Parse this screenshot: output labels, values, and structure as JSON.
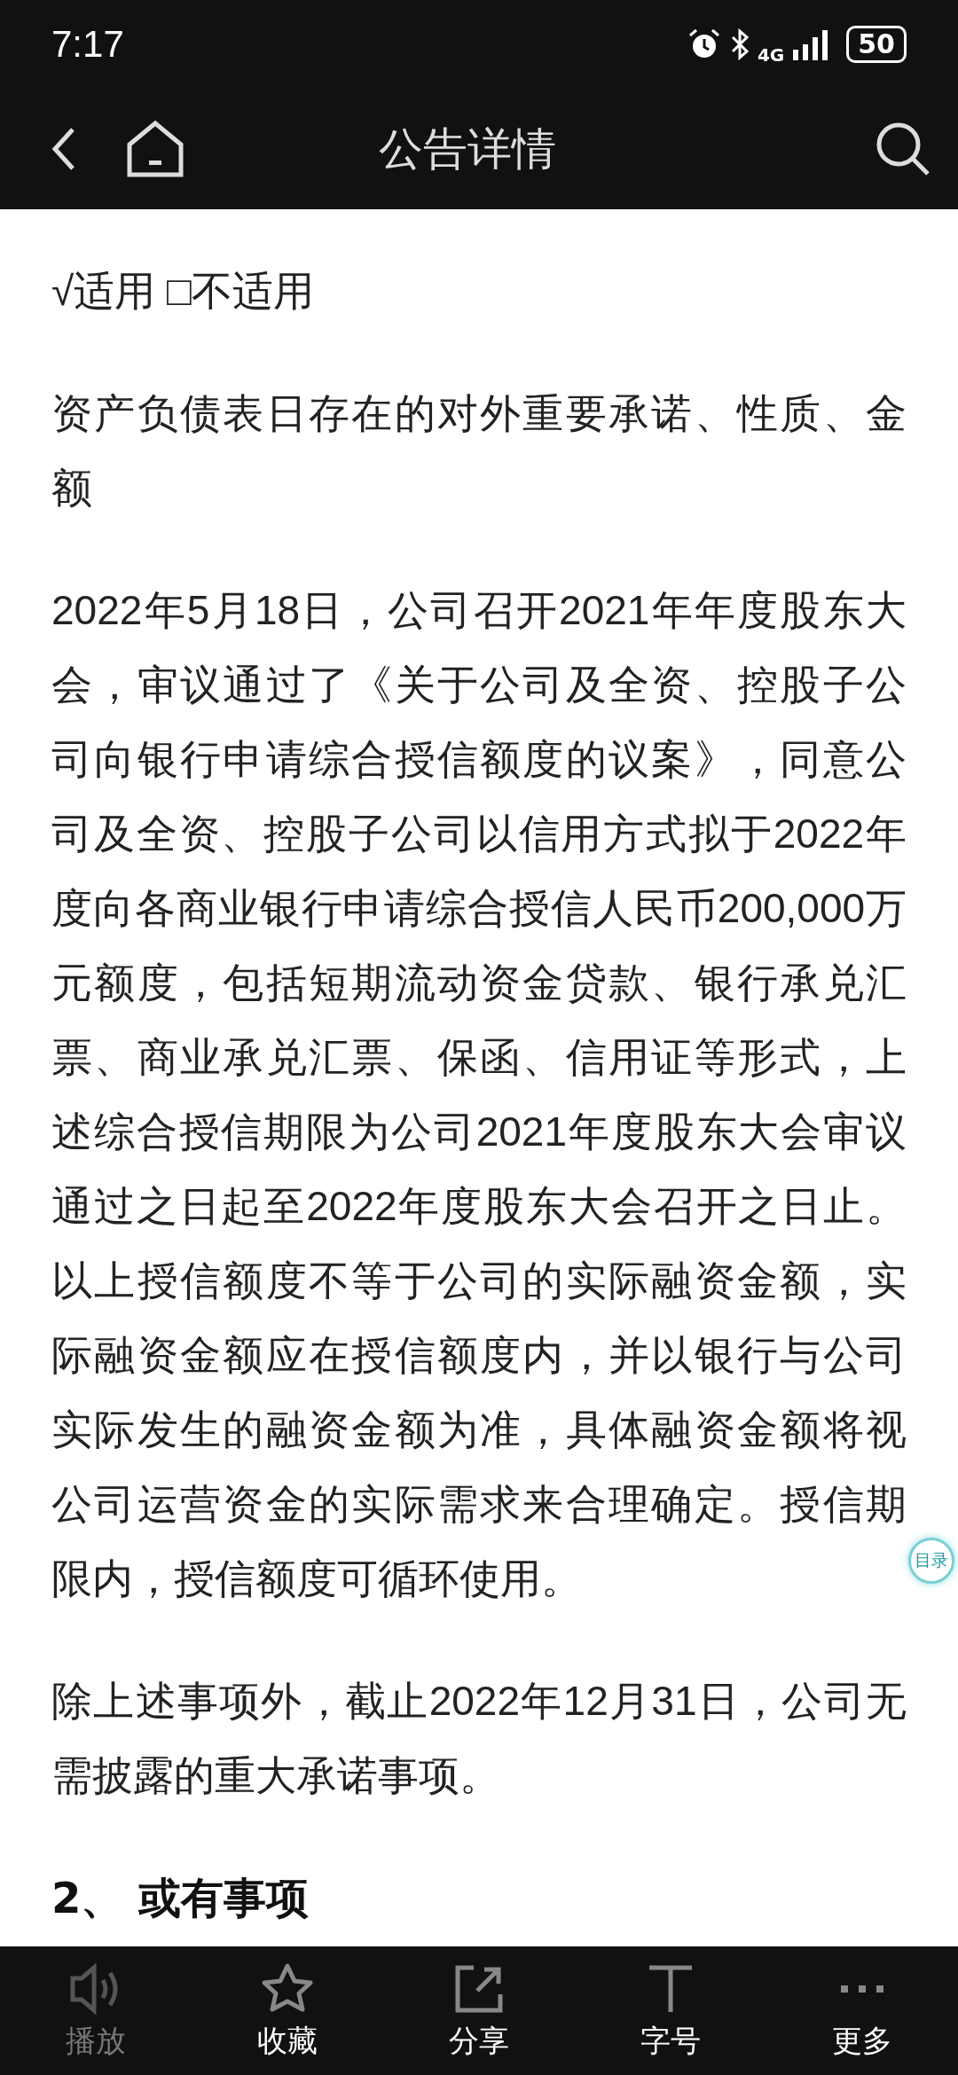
{
  "status_bar": {
    "time": "7:17",
    "network": "4G",
    "battery": "50"
  },
  "header": {
    "title": "公告详情"
  },
  "content": [
    {
      "kind": "paragraph",
      "text": "√适用 □不适用"
    },
    {
      "kind": "paragraph",
      "text": "资产负债表日存在的对外重要承诺、性质、金额"
    },
    {
      "kind": "paragraph",
      "text": "2022年5月18日，公司召开2021年年度股东大会，审议通过了《关于公司及全资、控股子公司向银行申请综合授信额度的议案》，同意公司及全资、控股子公司以信用方式拟于2022年度向各商业银行申请综合授信人民币200,000万元额度，包括短期流动资金贷款、银行承兑汇票、商业承兑汇票、保函、信用证等形式，上述综合授信期限为公司2021年度股东大会审议通过之日起至2022年度股东大会召开之日止。以上授信额度不等于公司的实际融资金额，实际融资金额应在授信额度内，并以银行与公司实际发生的融资金额为准，具体融资金额将视公司运营资金的实际需求来合理确定。授信期限内，授信额度可循环使用。"
    },
    {
      "kind": "paragraph",
      "text": "除上述事项外，截止2022年12月31日，公司无需披露的重大承诺事项。"
    },
    {
      "kind": "heading",
      "text": "2、 或有事项"
    }
  ],
  "toc_button": {
    "label": "目录"
  },
  "bottom_bar": [
    {
      "kind": "speaker",
      "label": "播放",
      "disabled": true
    },
    {
      "kind": "star",
      "label": "收藏",
      "disabled": false
    },
    {
      "kind": "share",
      "label": "分享",
      "disabled": false
    },
    {
      "kind": "font",
      "label": "字号",
      "disabled": false
    },
    {
      "kind": "more",
      "label": "更多",
      "disabled": false
    }
  ]
}
